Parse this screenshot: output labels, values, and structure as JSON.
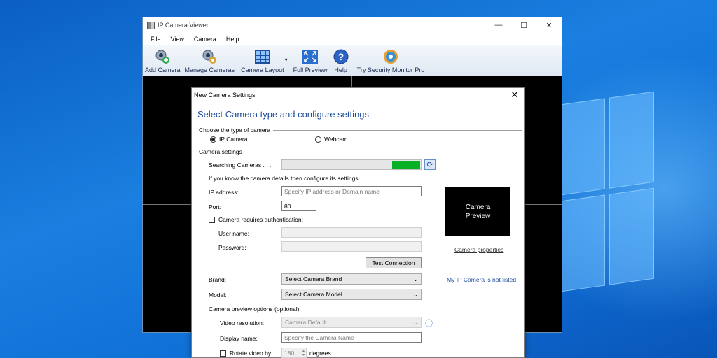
{
  "app": {
    "title": "IP Camera Viewer",
    "window_controls": {
      "minimize": "—",
      "maximize": "☐",
      "close": "✕"
    },
    "menu": [
      "File",
      "View",
      "Camera",
      "Help"
    ],
    "toolbar": {
      "add_camera": "Add Camera",
      "manage_cameras": "Manage Cameras",
      "camera_layout": "Camera Layout",
      "layout_dropdown": "▾",
      "full_preview": "Full Preview",
      "help": "Help",
      "try_pro": "Try Security Monitor Pro"
    }
  },
  "dialog": {
    "title": "New Camera Settings",
    "close": "✕",
    "heading": "Select Camera type and configure settings",
    "camera_type": {
      "section_label": "Choose the type of camera",
      "options": [
        "IP Camera",
        "Webcam"
      ],
      "selected": "IP Camera"
    },
    "settings": {
      "section_label": "Camera settings",
      "searching_label": "Searching Cameras . . .",
      "search_progress": 0.2,
      "refresh_icon": "⟳",
      "hint": "If you know the camera details then configure its settings:",
      "ip_label": "IP address:",
      "ip_placeholder": "Specify IP address or Domain name",
      "port_label": "Port:",
      "port_value": "80",
      "auth_label": "Camera requires authentication:",
      "username_label": "User name:",
      "password_label": "Password:",
      "test_button": "Test Connection",
      "brand_label": "Brand:",
      "brand_value": "Select Camera Brand",
      "model_label": "Model:",
      "model_value": "Select Camera Model",
      "preview_options_label": "Camera preview options (optional):",
      "resolution_label": "Video resolution:",
      "resolution_value": "Camera Default",
      "info_icon": "ⓘ",
      "display_name_label": "Display name:",
      "display_name_placeholder": "Specify the Camera Name",
      "rotate_label": "Rotate video by:",
      "rotate_value": "180",
      "rotate_unit": "degrees"
    },
    "preview": {
      "line1": "Camera",
      "line2": "Preview"
    },
    "camera_properties_link": "Camera properties",
    "not_listed_link": "My IP Camera is not listed"
  },
  "colors": {
    "heading": "#1f4e9c",
    "progress": "#06b025",
    "desktop": "#0f6fd6"
  }
}
